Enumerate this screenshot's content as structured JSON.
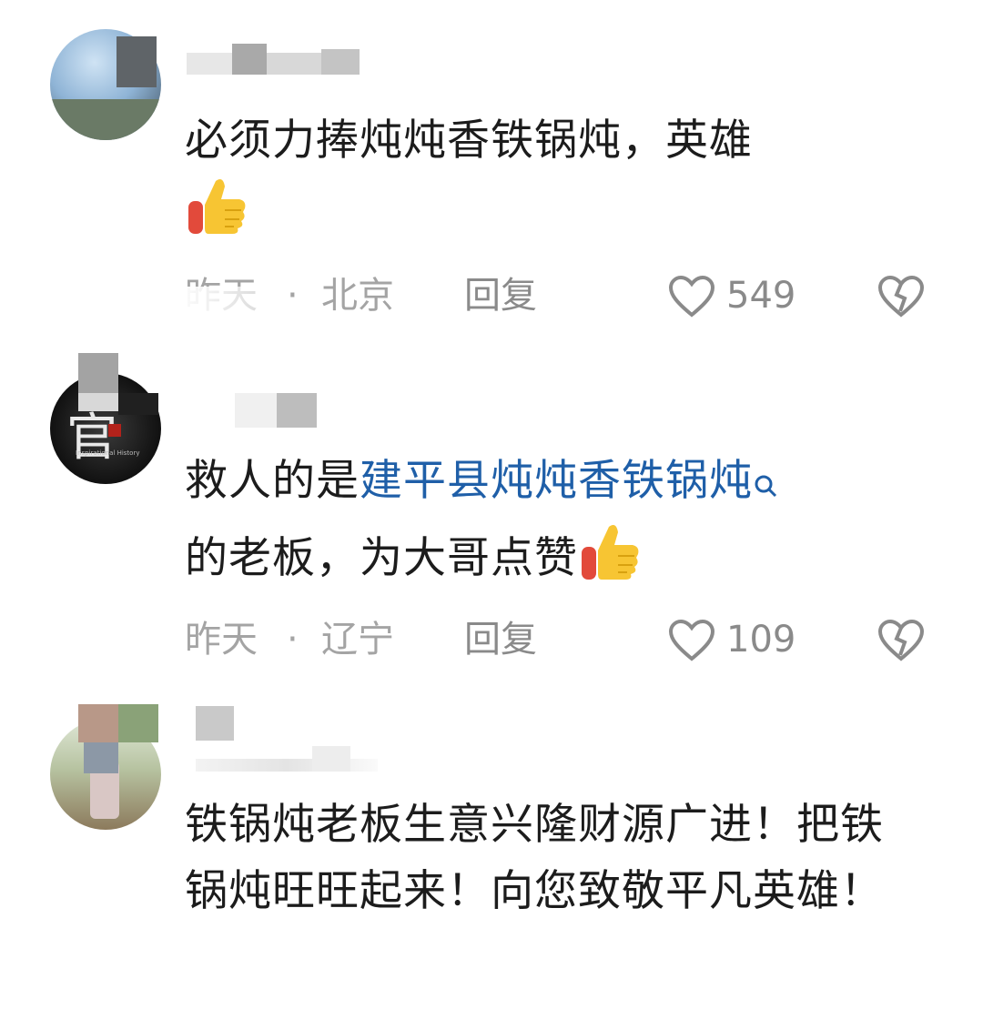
{
  "comments": [
    {
      "text": "必须力捧炖炖香铁锅炖，英雄",
      "time": "昨天",
      "separator": "·",
      "location": "北京",
      "reply_label": "回复",
      "likes": "549"
    },
    {
      "text_before": "救人的是",
      "link_text": "建平县炖炖香铁锅炖",
      "text_after": "的老板，为大哥点赞",
      "time": "昨天",
      "separator": "·",
      "location": "辽宁",
      "reply_label": "回复",
      "likes": "109"
    },
    {
      "text": "铁锅炖老板生意兴隆财源广进！把铁锅炖旺旺起来！向您致敬平凡英雄！"
    }
  ],
  "icons": {
    "like": "heart-outline-icon",
    "dislike": "broken-heart-icon",
    "search": "search-icon",
    "emoji": "thumbs-up-emoji"
  },
  "colors": {
    "link": "#1f5fa8",
    "meta": "#a4a4a4",
    "text": "#1c1c1c"
  }
}
